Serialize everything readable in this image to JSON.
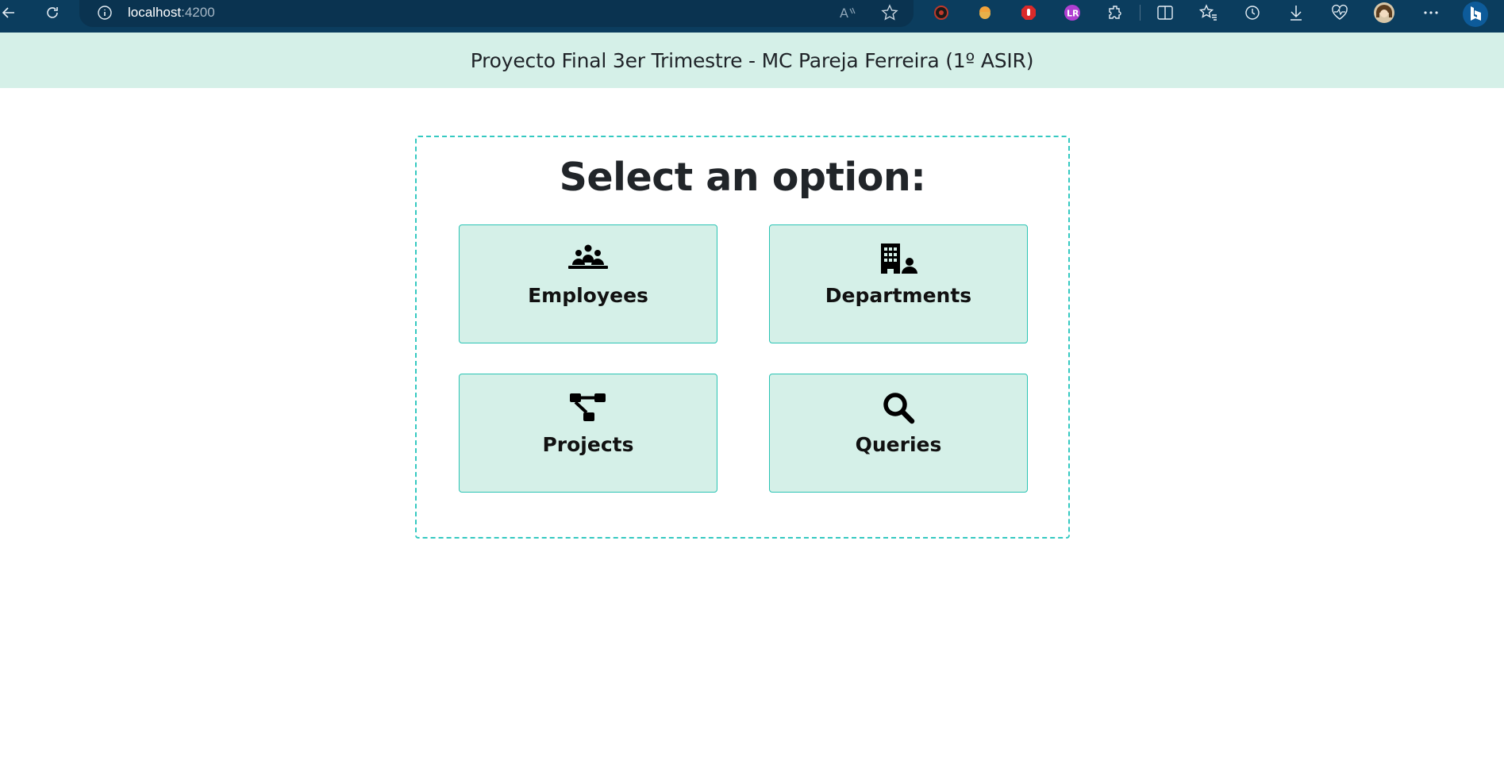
{
  "browser": {
    "url_host": "localhost",
    "url_port": ":4200",
    "toolbar_icons": [
      "back-icon",
      "reload-icon",
      "site-info-icon",
      "read-aloud-icon",
      "favorite-star-icon",
      "extension-icons",
      "extensions-icon",
      "split-screen-icon",
      "favorites-icon",
      "history-icon",
      "downloads-icon",
      "browser-essentials-icon",
      "profile-avatar",
      "more-icon",
      "copilot-icon"
    ]
  },
  "header": {
    "title": "Proyecto Final 3er Trimestre - MC Pareja Ferreira (1º ASIR)"
  },
  "main": {
    "heading": "Select an option:",
    "options": [
      {
        "label": "Employees",
        "icon": "people-meeting-icon"
      },
      {
        "label": "Departments",
        "icon": "building-user-icon"
      },
      {
        "label": "Projects",
        "icon": "diagram-project-icon"
      },
      {
        "label": "Queries",
        "icon": "magnifying-glass-icon"
      }
    ]
  },
  "colors": {
    "chrome": "#0b3d5e",
    "header_bg": "#d5f0e8",
    "card_border": "#35c9c1",
    "option_bg": "#d5f0e8",
    "option_border": "#2bc4b4"
  }
}
